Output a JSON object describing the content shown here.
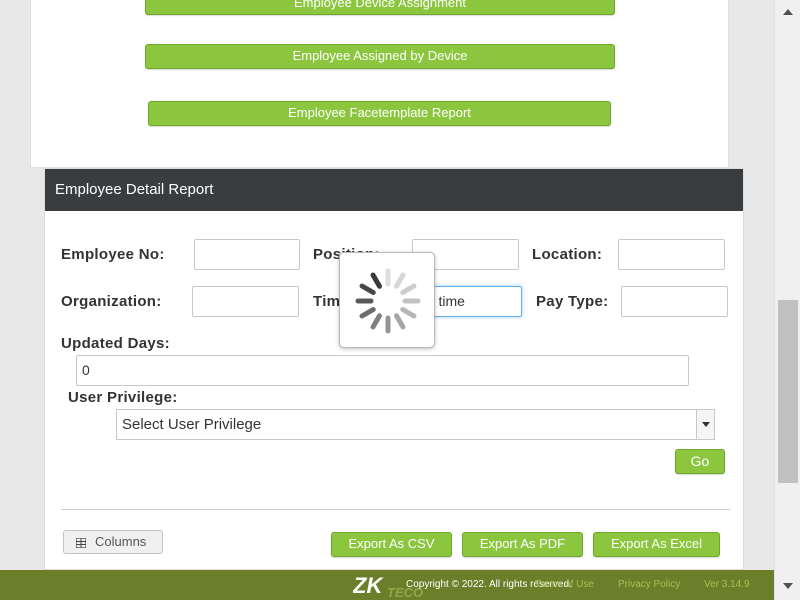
{
  "top_buttons": {
    "device_assignment": "Employee Device Assignment",
    "assigned_by_device": "Employee Assigned by Device",
    "facetemplate_report": "Employee Facetemplate Report"
  },
  "report": {
    "title": "Employee Detail Report",
    "labels": {
      "employee_no": "Employee No:",
      "position": "Position:",
      "location": "Location:",
      "organization": "Organization:",
      "time": "Time",
      "pay_type": "Pay Type:",
      "updated_days": "Updated Days:",
      "user_privilege": "User Privilege:"
    },
    "fields": {
      "employee_no": "",
      "position": "",
      "location": "",
      "organization": "",
      "time": "All time",
      "pay_type": "",
      "updated_days": "0"
    },
    "user_privilege_selected": "Select User Privilege",
    "go_label": "Go",
    "columns_label": "Columns",
    "export": {
      "csv": "Export As CSV",
      "pdf": "Export As PDF",
      "excel": "Export As Excel"
    }
  },
  "footer": {
    "copyright": "Copyright © 2022. All rights reserved.",
    "terms": "Terms of Use",
    "privacy": "Privacy Policy",
    "version": "Ver 3.14.9"
  },
  "colors": {
    "accent_green": "#8cc63f",
    "header_dark": "#3a3d40",
    "footer_olive": "#6b7f2a"
  },
  "icons": {
    "columns": "grid-icon",
    "loading": "spinner-icon"
  }
}
